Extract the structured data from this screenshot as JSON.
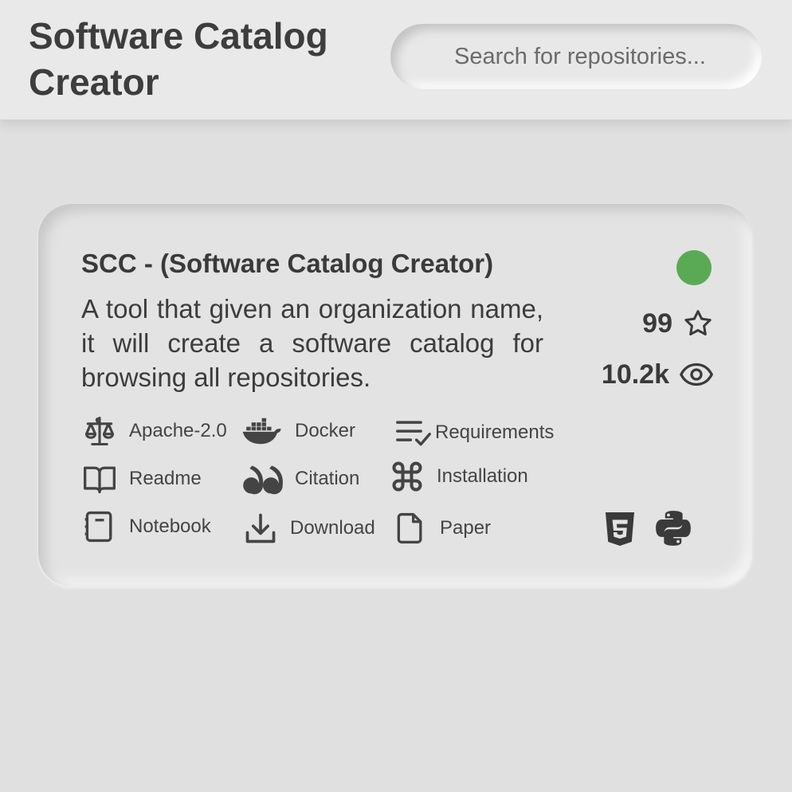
{
  "app": {
    "title": "Software Catalog Creator"
  },
  "search": {
    "placeholder": "Search for repositories..."
  },
  "repo": {
    "name": "SCC - (Software Catalog Creator)",
    "description": "A tool that given an organization name, it will create a software catalog for browsing all repositories.",
    "status_color": "#5aaa55",
    "stars": "99",
    "watchers": "10.2k",
    "features": [
      {
        "label": "Apache-2.0",
        "icon": "scale-icon"
      },
      {
        "label": "Docker",
        "icon": "docker-icon"
      },
      {
        "label": "Requirements",
        "icon": "checklist-icon"
      },
      {
        "label": "Readme",
        "icon": "book-icon"
      },
      {
        "label": "Citation",
        "icon": "quote-icon"
      },
      {
        "label": "Installation",
        "icon": "command-icon"
      },
      {
        "label": "Notebook",
        "icon": "notebook-icon"
      },
      {
        "label": "Download",
        "icon": "download-icon"
      },
      {
        "label": "Paper",
        "icon": "file-icon"
      }
    ],
    "languages": [
      {
        "name": "html5-icon"
      },
      {
        "name": "python-icon"
      }
    ]
  }
}
